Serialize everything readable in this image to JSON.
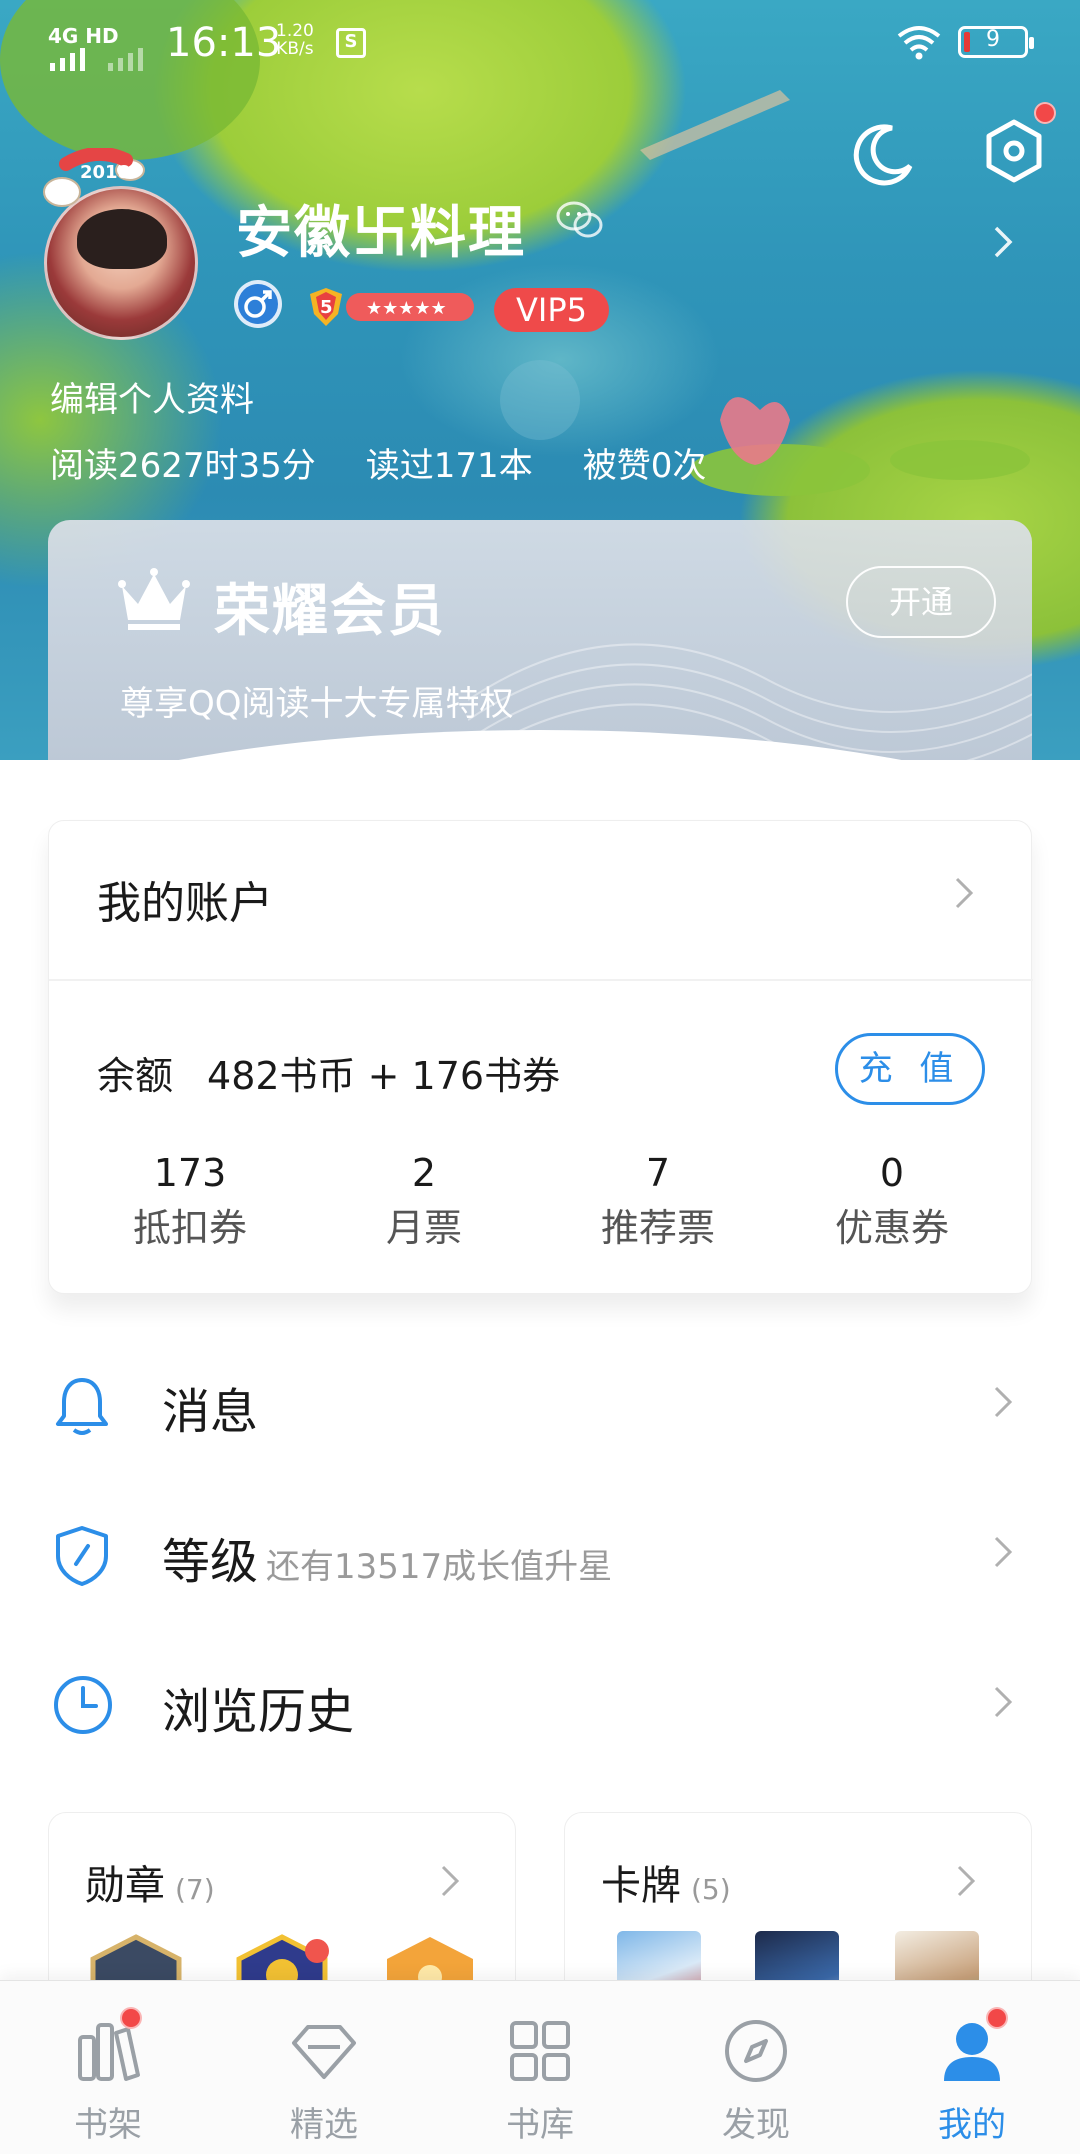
{
  "status_bar": {
    "network": "4G HD",
    "time": "16:13",
    "speed_value": "1.20",
    "speed_unit": "KB/s",
    "battery": "9"
  },
  "profile": {
    "nickname": "安徽卐料理",
    "avatar_badge": "2018",
    "level": "5",
    "vip_badge": "VIP5",
    "edit_label": "编辑个人资料",
    "reading_time": "阅读2627时35分",
    "books_read": "读过171本",
    "likes": "被赞0次"
  },
  "vip_card": {
    "title": "荣耀会员",
    "subtitle": "尊享QQ阅读十大专属特权",
    "open_label": "开通"
  },
  "account": {
    "title": "我的账户",
    "balance_label": "余额",
    "balance_value": "482书币 + 176书券",
    "recharge_label": "充 值",
    "tickets": [
      {
        "count": "173",
        "label": "抵扣券"
      },
      {
        "count": "2",
        "label": "月票"
      },
      {
        "count": "7",
        "label": "推荐票"
      },
      {
        "count": "0",
        "label": "优惠券"
      }
    ]
  },
  "menu": [
    {
      "label": "消息",
      "sub": "",
      "icon": "bell-icon"
    },
    {
      "label": "等级",
      "sub": "还有13517成长值升星",
      "icon": "shield-icon"
    },
    {
      "label": "浏览历史",
      "sub": "",
      "icon": "clock-icon"
    }
  ],
  "cards": {
    "medals": {
      "title": "勋章",
      "count": "(7)"
    },
    "cards": {
      "title": "卡牌",
      "count": "(5)"
    }
  },
  "nav": [
    {
      "label": "书架",
      "icon": "bookshelf-icon",
      "badge": true
    },
    {
      "label": "精选",
      "icon": "diamond-icon",
      "badge": false
    },
    {
      "label": "书库",
      "icon": "grid-icon",
      "badge": false
    },
    {
      "label": "发现",
      "icon": "compass-icon",
      "badge": false
    },
    {
      "label": "我的",
      "icon": "user-icon",
      "badge": true
    }
  ],
  "colors": {
    "accent": "#2c8ee8",
    "vip_red": "#ef4a4a",
    "badge_red": "#f24848",
    "nav_inactive": "#9aa0a6"
  }
}
